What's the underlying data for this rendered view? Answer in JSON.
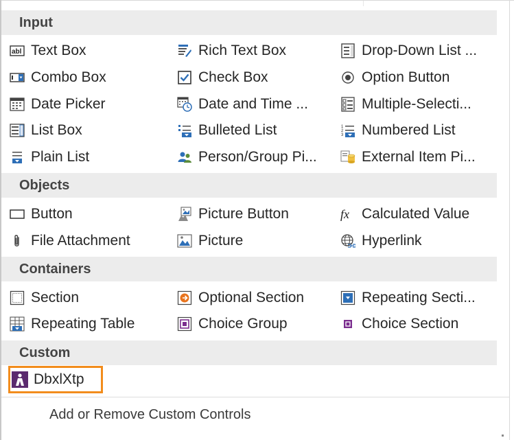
{
  "sections": {
    "input": {
      "title": "Input",
      "items": [
        {
          "label": "Text Box",
          "icon": "text-box-icon"
        },
        {
          "label": "Rich Text Box",
          "icon": "rich-text-box-icon"
        },
        {
          "label": "Drop-Down List ...",
          "icon": "drop-down-list-icon"
        },
        {
          "label": "Combo Box",
          "icon": "combo-box-icon"
        },
        {
          "label": "Check Box",
          "icon": "check-box-icon"
        },
        {
          "label": "Option Button",
          "icon": "option-button-icon"
        },
        {
          "label": "Date Picker",
          "icon": "date-picker-icon"
        },
        {
          "label": "Date and Time ...",
          "icon": "date-time-picker-icon"
        },
        {
          "label": "Multiple-Selecti...",
          "icon": "multiple-selection-list-icon"
        },
        {
          "label": "List Box",
          "icon": "list-box-icon"
        },
        {
          "label": "Bulleted List",
          "icon": "bulleted-list-icon"
        },
        {
          "label": "Numbered List",
          "icon": "numbered-list-icon"
        },
        {
          "label": "Plain List",
          "icon": "plain-list-icon"
        },
        {
          "label": "Person/Group Pi...",
          "icon": "person-group-picker-icon"
        },
        {
          "label": "External Item Pi...",
          "icon": "external-item-picker-icon"
        }
      ]
    },
    "objects": {
      "title": "Objects",
      "items": [
        {
          "label": "Button",
          "icon": "button-icon"
        },
        {
          "label": "Picture Button",
          "icon": "picture-button-icon"
        },
        {
          "label": "Calculated Value",
          "icon": "calculated-value-icon"
        },
        {
          "label": "File Attachment",
          "icon": "paperclip-icon"
        },
        {
          "label": "Picture",
          "icon": "picture-icon"
        },
        {
          "label": "Hyperlink",
          "icon": "hyperlink-globe-icon"
        }
      ]
    },
    "containers": {
      "title": "Containers",
      "items": [
        {
          "label": "Section",
          "icon": "section-icon"
        },
        {
          "label": "Optional Section",
          "icon": "optional-section-icon"
        },
        {
          "label": "Repeating Secti...",
          "icon": "repeating-section-icon"
        },
        {
          "label": "Repeating Table",
          "icon": "repeating-table-icon"
        },
        {
          "label": "Choice Group",
          "icon": "choice-group-icon"
        },
        {
          "label": "Choice Section",
          "icon": "choice-section-icon"
        }
      ]
    },
    "custom": {
      "title": "Custom",
      "items": [
        {
          "label": "DbxlXtp",
          "icon": "custom-control-icon"
        }
      ]
    }
  },
  "footer": {
    "label": "Add or Remove Custom Controls"
  },
  "colors": {
    "header_bg": "#ececec",
    "selection_border": "#f28c1c",
    "icon_blue": "#2e6fb7",
    "icon_purple": "#7b2d8e",
    "icon_orange": "#e8731c"
  }
}
